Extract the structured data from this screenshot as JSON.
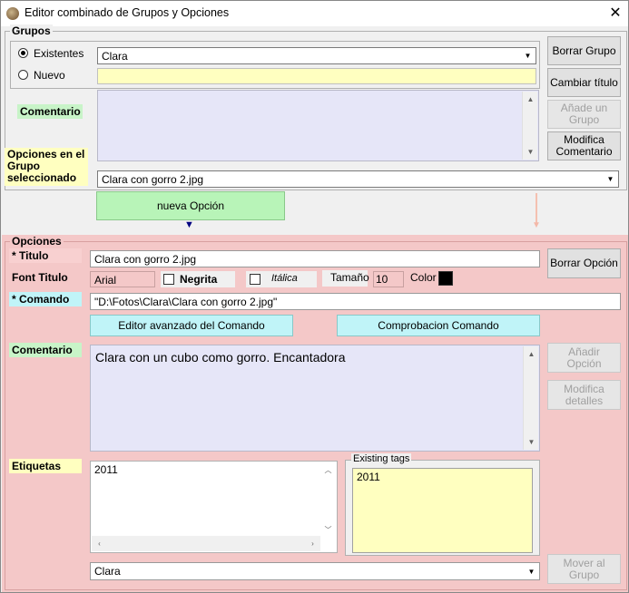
{
  "window": {
    "title": "Editor combinado de Grupos y Opciones",
    "close_glyph": "✕"
  },
  "grupos": {
    "section_label": "Grupos",
    "radio_existentes": "Existentes",
    "radio_nuevo": "Nuevo",
    "selected_group": "Clara",
    "nuevo_value": "",
    "comentario_label": "Comentario",
    "comentario_value": "",
    "opciones_label": "Opciones en el Grupo seleccionado",
    "opcion_selected": "Clara con gorro 2.jpg",
    "buttons": {
      "borrar_grupo": "Borrar Grupo",
      "cambiar_titulo": "Cambiar título",
      "anade_grupo": "Añade un Grupo",
      "modifica_comentario": "Modifica Comentario"
    },
    "nueva_opcion": "nueva Opción"
  },
  "opciones": {
    "section_label": "Opciones",
    "titulo_label": "* Titulo",
    "titulo_value": "Clara con gorro 2.jpg",
    "borrar_opcion": "Borrar Opción",
    "font_label": "Font Titulo",
    "font_value": "Arial",
    "negrita": "Negrita",
    "italica": "Itálica",
    "tamano_label": "Tamaño",
    "tamano_value": "10",
    "color_label": "Color",
    "color_value": "#000000",
    "comando_label": "* Comando",
    "comando_value": "\"D:\\Fotos\\Clara\\Clara con gorro 2.jpg\"",
    "editor_avanzado": "Editor avanzado del Comando",
    "comprobacion": "Comprobacion Comando",
    "comentario_label": "Comentario",
    "comentario_value": "Clara con un cubo como gorro. Encantadora",
    "anadir_opcion": "Añadir Opción",
    "modifica_detalles": "Modifica detalles",
    "etiquetas_label": "Etiquetas",
    "etiquetas_value": "2011",
    "existing_tags_label": "Existing tags",
    "existing_tags_value": "2011",
    "grupo_destino": "Clara",
    "mover_al_grupo": "Mover al Grupo"
  },
  "colors": {
    "pink": "#f4c8c8",
    "lavender": "#e6e6f8",
    "light_yellow": "#ffffc0",
    "green_label": "#c8f4c8",
    "cyan_label": "#c0f4f8",
    "green_button": "#b8f4b8"
  }
}
